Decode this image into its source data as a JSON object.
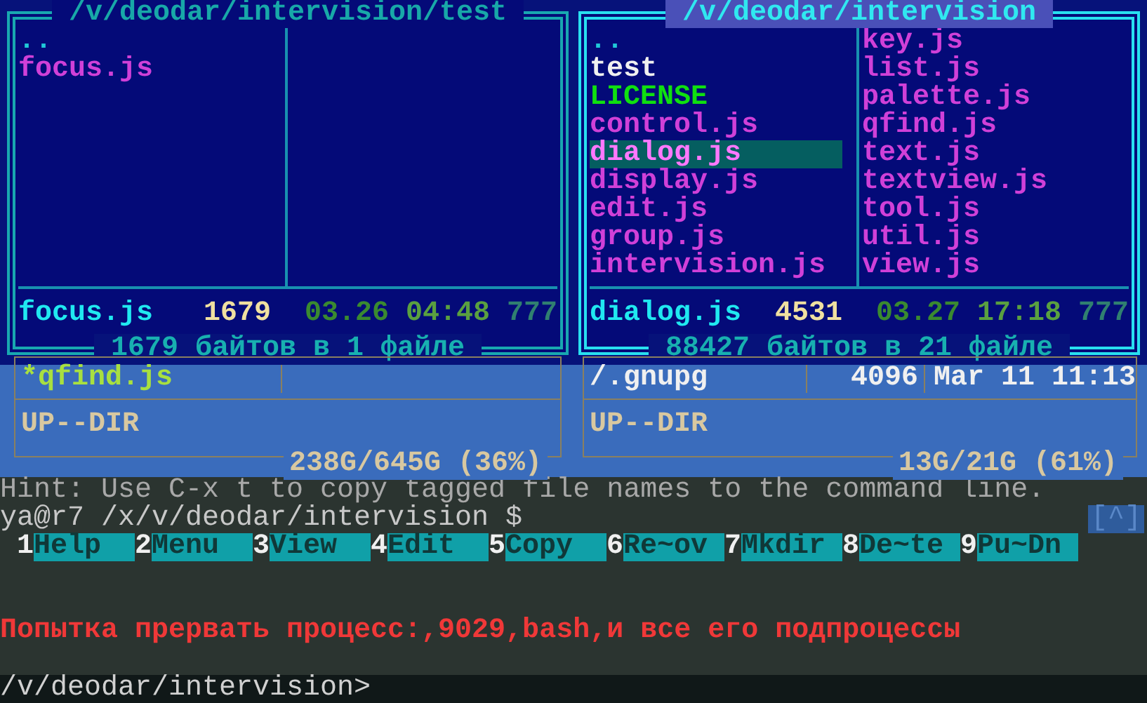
{
  "panels": [
    {
      "title": "/v/deodar/intervision/test",
      "selected": false,
      "columns": [
        [
          {
            "name": "..",
            "kind": "parent",
            "selected": false
          },
          {
            "name": "focus.js",
            "kind": "file",
            "selected": false
          }
        ],
        []
      ],
      "info": {
        "name": "focus.js",
        "size": "1679",
        "date": "03.26",
        "time": "04:48",
        "mode": "777"
      },
      "summary": "1679 байтов в 1 файле"
    },
    {
      "title": "/v/deodar/intervision",
      "selected": true,
      "columns": [
        [
          {
            "name": "..",
            "kind": "parent",
            "selected": false
          },
          {
            "name": "test",
            "kind": "dir",
            "selected": false
          },
          {
            "name": "LICENSE",
            "kind": "exec",
            "selected": false
          },
          {
            "name": "control.js",
            "kind": "file",
            "selected": false
          },
          {
            "name": "dialog.js",
            "kind": "file",
            "selected": true
          },
          {
            "name": "display.js",
            "kind": "file",
            "selected": false
          },
          {
            "name": "edit.js",
            "kind": "file",
            "selected": false
          },
          {
            "name": "group.js",
            "kind": "file",
            "selected": false
          },
          {
            "name": "intervision.js",
            "kind": "file",
            "selected": false
          }
        ],
        [
          {
            "name": "key.js",
            "kind": "file",
            "selected": false
          },
          {
            "name": "list.js",
            "kind": "file",
            "selected": false
          },
          {
            "name": "palette.js",
            "kind": "file",
            "selected": false
          },
          {
            "name": "qfind.js",
            "kind": "file",
            "selected": false
          },
          {
            "name": "text.js",
            "kind": "file",
            "selected": false
          },
          {
            "name": "textview.js",
            "kind": "file",
            "selected": false
          },
          {
            "name": "tool.js",
            "kind": "file",
            "selected": false
          },
          {
            "name": "util.js",
            "kind": "file",
            "selected": false
          },
          {
            "name": "view.js",
            "kind": "file",
            "selected": false
          }
        ]
      ],
      "info": {
        "name": "dialog.js",
        "size": "4531",
        "date": "03.27",
        "time": "17:18",
        "mode": "777"
      },
      "summary": "88427 байтов в 21 файле"
    }
  ],
  "back_panels": [
    {
      "entry": {
        "name": "*qfind.js",
        "kind": "tagged"
      },
      "status": "UP--DIR",
      "disk": "238G/645G (36%)"
    },
    {
      "entry": {
        "name": "/.gnupg",
        "kind": "dir",
        "size": "4096",
        "date": "Mar 11 11:13"
      },
      "status": "UP--DIR",
      "disk": "13G/21G (61%)"
    }
  ],
  "hint": "Hint: Use C-x t to copy tagged file names to the command line.",
  "prompt": "ya@r7 /x/v/deodar/intervision $",
  "scroll_button": "[^]",
  "function_keys": [
    {
      "number": "1",
      "label": "Help"
    },
    {
      "number": "2",
      "label": "Menu"
    },
    {
      "number": "3",
      "label": "View"
    },
    {
      "number": "4",
      "label": "Edit"
    },
    {
      "number": "5",
      "label": "Copy"
    },
    {
      "number": "6",
      "label": "Re~ov"
    },
    {
      "number": "7",
      "label": "Mkdir"
    },
    {
      "number": "8",
      "label": "De~te"
    },
    {
      "number": "9",
      "label": "Pu~Dn"
    }
  ],
  "message": "Попытка прервать процесс:,9029,bash,и все его подпроцессы",
  "command_line": "/v/deodar/intervision>"
}
